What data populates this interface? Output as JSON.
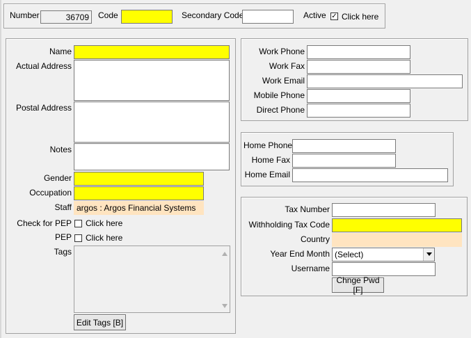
{
  "header": {
    "number_label": "Number",
    "number_value": "36709",
    "code_label": "Code",
    "code_value": "",
    "secondary_code_label": "Secondary Code",
    "secondary_code_value": "",
    "active_label": "Active",
    "active_checked": true,
    "active_checkbox_text": "Click here"
  },
  "left": {
    "name_label": "Name",
    "name_value": "",
    "actual_address_label": "Actual Address",
    "actual_address_value": "",
    "postal_address_label": "Postal Address",
    "postal_address_value": "",
    "notes_label": "Notes",
    "notes_value": "",
    "gender_label": "Gender",
    "gender_value": "",
    "occupation_label": "Occupation",
    "occupation_value": "",
    "staff_label": "Staff",
    "staff_value": "argos : Argos Financial Systems",
    "pep_check_label": "Check for PEP",
    "pep_check_text": "Click here",
    "pep_label": "PEP",
    "pep_text": "Click here",
    "tags_label": "Tags",
    "edit_tags_button": "Edit Tags [B]"
  },
  "work": {
    "work_phone_label": "Work Phone",
    "work_fax_label": "Work Fax",
    "work_email_label": "Work Email",
    "mobile_phone_label": "Mobile Phone",
    "direct_phone_label": "Direct Phone"
  },
  "home": {
    "home_phone_label": "Home Phone",
    "home_fax_label": "Home Fax",
    "home_email_label": "Home Email"
  },
  "tax": {
    "tax_number_label": "Tax Number",
    "withholding_label": "Withholding Tax Code",
    "country_label": "Country",
    "year_end_label": "Year End Month",
    "year_end_value": "(Select)",
    "username_label": "Username",
    "change_pwd_button": "Chnge Pwd [F]"
  },
  "colors": {
    "required_field": "#ffff00",
    "readonly_field": "#ffe4c0",
    "background": "#f0f0f0"
  }
}
